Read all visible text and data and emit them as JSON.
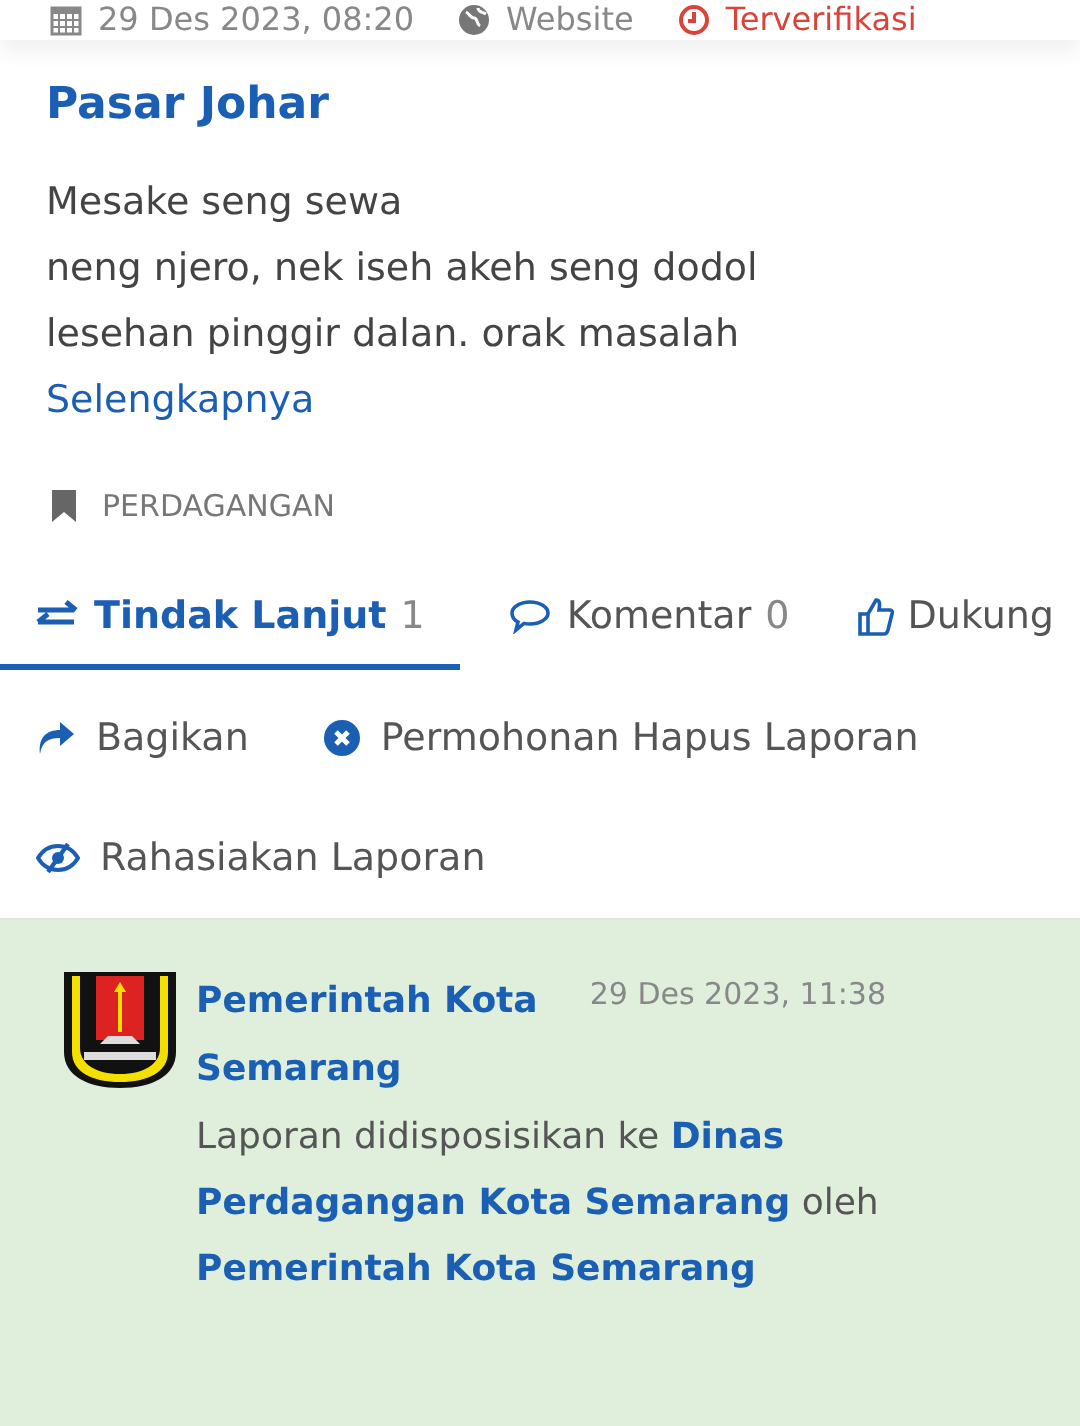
{
  "meta": [
    {
      "kind": "date",
      "text": "29 Des 2023, 08:20"
    },
    {
      "kind": "source",
      "text": "Website"
    },
    {
      "kind": "status",
      "text": "Terverifikasi"
    }
  ],
  "title": "Pasar Johar",
  "description_lines": [
    "Mesake seng sewa",
    "neng njero, nek iseh akeh seng dodol",
    "lesehan pinggir dalan. orak masalah"
  ],
  "read_more": "Selengkapnya",
  "category": "PERDAGANGAN",
  "tabs": [
    {
      "kind": "followup",
      "label": "Tindak Lanjut",
      "count": "1",
      "selected": true
    },
    {
      "kind": "comment",
      "label": "Komentar",
      "count": "0",
      "selected": false
    },
    {
      "kind": "support",
      "label": "Dukung",
      "selected": false
    }
  ],
  "actions": [
    {
      "kind": "share",
      "label": "Bagikan"
    },
    {
      "kind": "delete",
      "label": "Permohonan Hapus Laporan"
    },
    {
      "kind": "hide",
      "label": "Rahasiakan Laporan"
    }
  ],
  "followups": [
    {
      "author": "Pemerintah Kota Semarang",
      "time": "29 Des 2023, 11:38",
      "message": "Laporan didisposisikan ke **Dinas Perdagangan Kota Semarang** oleh **Pemerintah Kota Semarang**"
    }
  ]
}
